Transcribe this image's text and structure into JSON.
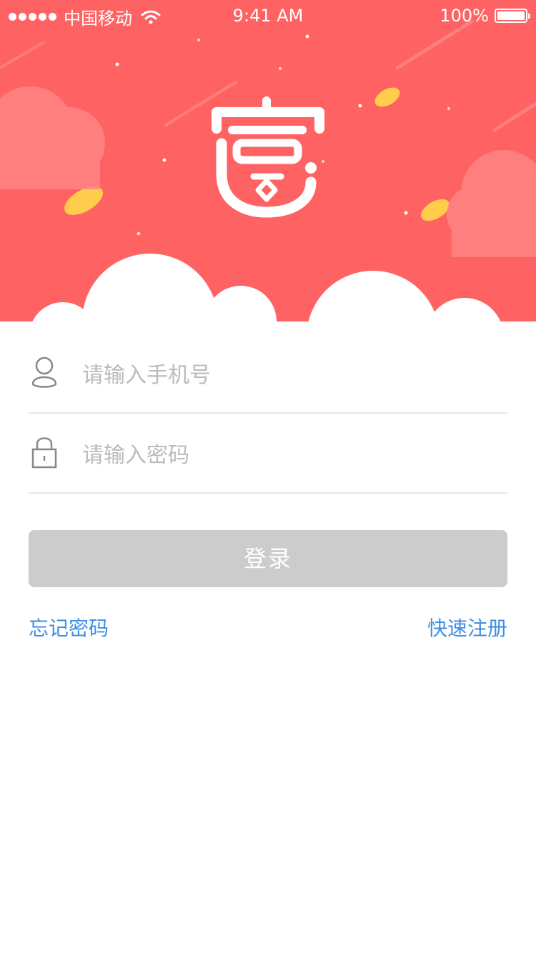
{
  "status_bar": {
    "carrier": "中国移动",
    "time": "9:41 AM",
    "battery": "100%"
  },
  "hero": {
    "background_color": "#ff6262",
    "logo_icon": "yi-piggy-logo-icon"
  },
  "form": {
    "phone_placeholder": "请输入手机号",
    "phone_value": "",
    "password_placeholder": "请输入密码",
    "password_value": "",
    "phone_icon": "user-icon",
    "password_icon": "lock-icon"
  },
  "actions": {
    "login_label": "登录",
    "forgot_label": "忘记密码",
    "register_label": "快速注册",
    "link_color": "#3d8ee6",
    "login_disabled_color": "#cccccc"
  }
}
